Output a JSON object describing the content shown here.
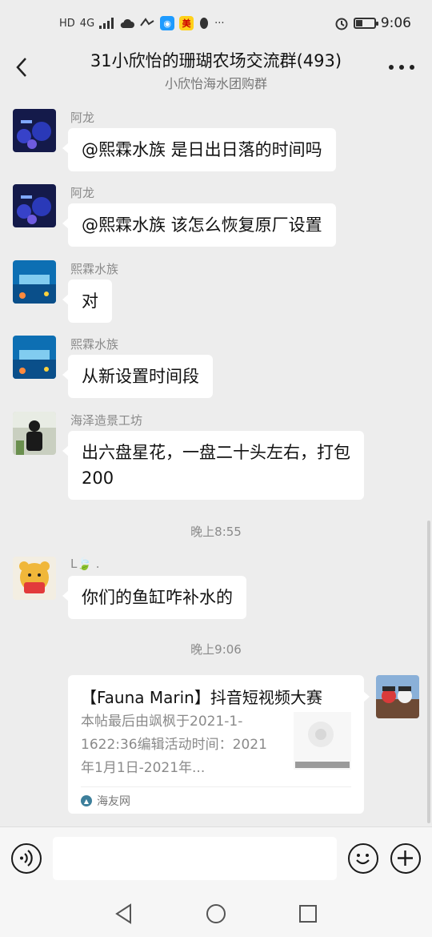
{
  "status_bar": {
    "hd": "HD",
    "net": "4G",
    "meituan_chip": "美",
    "more": "···",
    "time": "9:06"
  },
  "header": {
    "title": "31小欣怡的珊瑚农场交流群(493)",
    "subtitle": "小欣怡海水团购群"
  },
  "messages": [
    {
      "sender": "阿龙",
      "text": "@熙霖水族  是日出日落的时间吗"
    },
    {
      "sender": "阿龙",
      "text": "@熙霖水族  该怎么恢复原厂设置"
    },
    {
      "sender": "熙霖水族",
      "text": "对"
    },
    {
      "sender": "熙霖水族",
      "text": "从新设置时间段"
    },
    {
      "sender": "海泽造景工坊",
      "text": "出六盘星花，一盘二十头左右，打包 200"
    },
    {
      "sender": "L🍃 .",
      "text": "你们的鱼缸咋补水的"
    }
  ],
  "timestamps": [
    "晚上8:55",
    "晚上9:06"
  ],
  "link_card": {
    "title": "【Fauna Marin】抖音短视频大赛",
    "description": "本帖最后由飒枫于2021-1-1622:36编辑活动时间：2021年1月1日-2021年...",
    "source": "海友网"
  },
  "input": {
    "value": ""
  },
  "colors": {
    "background": "#ededed",
    "bubble": "#ffffff",
    "meta_text": "#8a8a8a"
  }
}
